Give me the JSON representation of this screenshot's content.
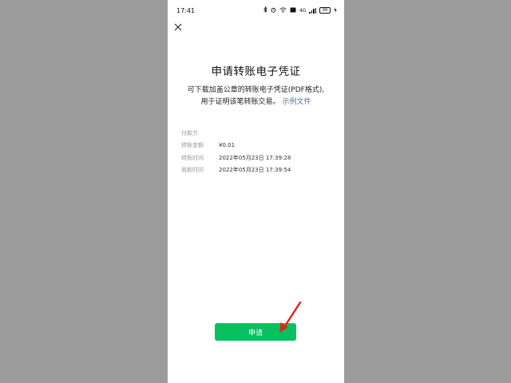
{
  "status_bar": {
    "time": "17:41",
    "network_label": "4G",
    "battery_level": "99",
    "icons": [
      "bluetooth-icon",
      "alarm-icon",
      "wifi-icon",
      "hd-icon",
      "signal-icon",
      "battery-icon",
      "charging-icon"
    ]
  },
  "header": {
    "close_icon": "close-icon",
    "title": "申请转账电子凭证"
  },
  "description": {
    "line1": "可下载加盖公章的转账电子凭证(PDF格式),",
    "line2": "用于证明该笔转账交易。",
    "link": "示例文件"
  },
  "info": {
    "rows": [
      {
        "label": "付款方",
        "value": ""
      },
      {
        "label": "转账金额",
        "value": "¥0.01"
      },
      {
        "label": "转账时间",
        "value": "2022年05月23日 17:39:28"
      },
      {
        "label": "收款时间",
        "value": "2022年05月23日 17:39:54"
      }
    ]
  },
  "actions": {
    "apply_label": "申请"
  },
  "colors": {
    "accent_green": "#07c160",
    "link_blue": "#576b95",
    "annotation_red": "#e0241b",
    "backdrop_gray": "#9c9c9c"
  }
}
